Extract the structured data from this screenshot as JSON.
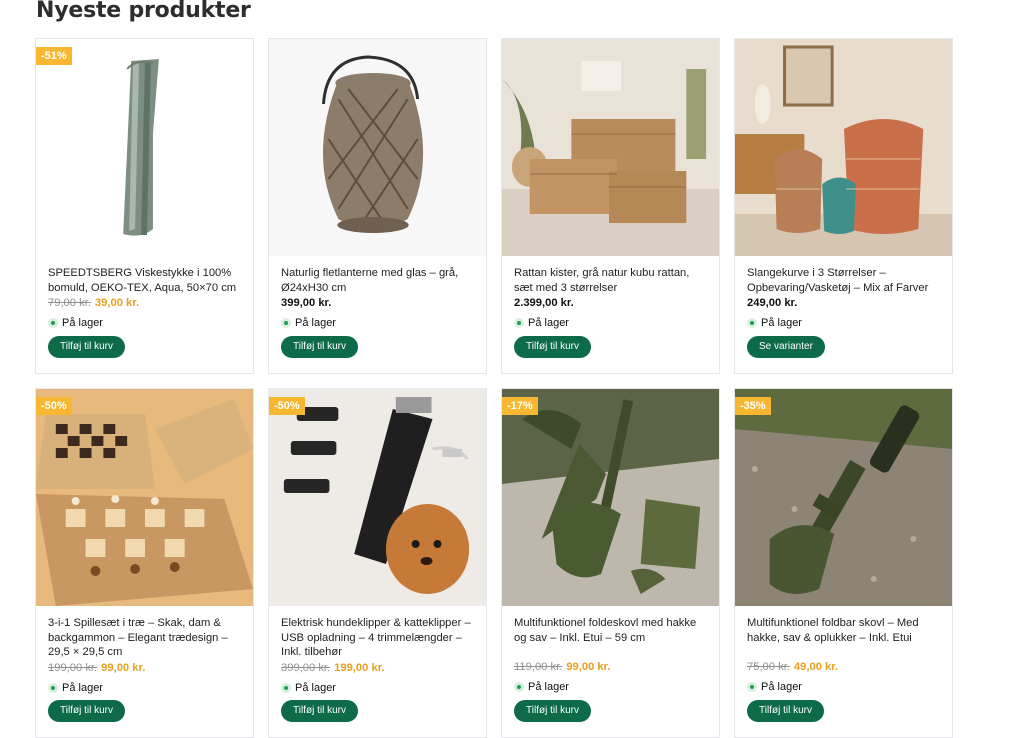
{
  "section": {
    "title": "Nyeste produkter"
  },
  "products": [
    {
      "name": "SPEEDTSBERG Viskestykke i 100% bomuld, OEKO-TEX, Aqua, 50×70 cm",
      "badge": "-51%",
      "price_old": "79,00 kr.",
      "price": "39,00 kr.",
      "stock": "På lager",
      "button": "Tilføj til kurv",
      "image": "tea-towel"
    },
    {
      "name": "Naturlig fletlanterne med glas – grå, Ø24xH30 cm",
      "badge": "",
      "price_old": "",
      "price": "399,00 kr.",
      "stock": "På lager",
      "button": "Tilføj til kurv",
      "image": "lantern"
    },
    {
      "name": "Rattan kister, grå natur kubu rattan, sæt med 3 størrelser",
      "badge": "",
      "price_old": "",
      "price": "2.399,00 kr.",
      "stock": "På lager",
      "button": "Tilføj til kurv",
      "image": "rattan-chests"
    },
    {
      "name": "Slangekurve i 3 Størrelser – Opbevaring/Vasketøj – Mix af Farver",
      "badge": "",
      "price_old": "",
      "price": "249,00 kr.",
      "stock": "På lager",
      "button": "Se varianter",
      "image": "baskets"
    },
    {
      "name": "3-i-1 Spillesæt i træ – Skak, dam & backgammon – Elegant trædesign – 29,5 × 29,5 cm",
      "badge": "-50%",
      "price_old": "199,00 kr.",
      "price": "99,00 kr.",
      "stock": "På lager",
      "button": "Tilføj til kurv",
      "image": "chess-set"
    },
    {
      "name": "Elektrisk hundeklipper & katteklipper – USB opladning – 4 trimmelængder – Inkl. tilbehør",
      "badge": "-50%",
      "price_old": "399,00 kr.",
      "price": "199,00 kr.",
      "stock": "På lager",
      "button": "Tilføj til kurv",
      "image": "pet-clipper"
    },
    {
      "name": "Multifunktionel foldeskovl med hakke og sav – Inkl. Etui – 59 cm",
      "badge": "-17%",
      "price_old": "119,00 kr.",
      "price": "99,00 kr.",
      "stock": "På lager",
      "button": "Tilføj til kurv",
      "image": "folding-shovel"
    },
    {
      "name": "Multifunktionel foldbar skovl – Med hakke, sav & oplukker – Inkl. Etui",
      "badge": "-35%",
      "price_old": "75,00 kr.",
      "price": "49,00 kr.",
      "stock": "På lager",
      "button": "Tilføj til kurv",
      "image": "foldable-shovel"
    }
  ]
}
